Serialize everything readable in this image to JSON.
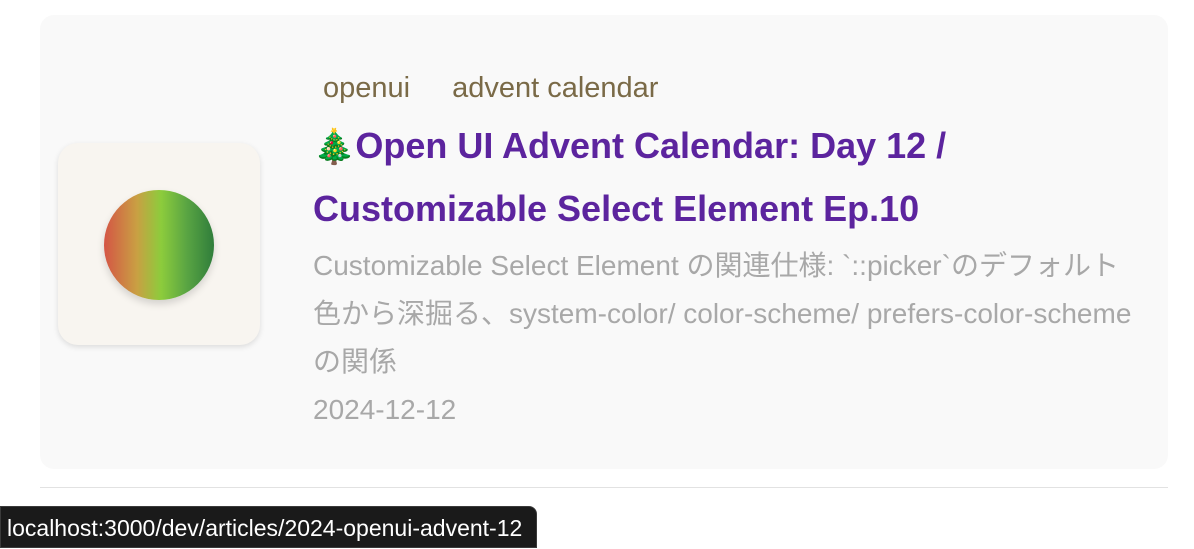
{
  "article": {
    "tags": [
      "openui",
      "advent calendar"
    ],
    "title_emoji": "🎄",
    "title": "Open UI Advent Calendar: Day 12 / Customizable Select Element Ep.10",
    "description": "Customizable Select Element の関連仕様: `::picker`のデフォルト色から深掘る、system-color/ color-scheme/ prefers-color-scheme の関係",
    "date": "2024-12-12"
  },
  "status_bar": {
    "url": "localhost:3000/dev/articles/2024-openui-advent-12"
  },
  "colors": {
    "title": "#5c249e",
    "tag": "#7a6a47",
    "muted": "#a8a8a8"
  }
}
